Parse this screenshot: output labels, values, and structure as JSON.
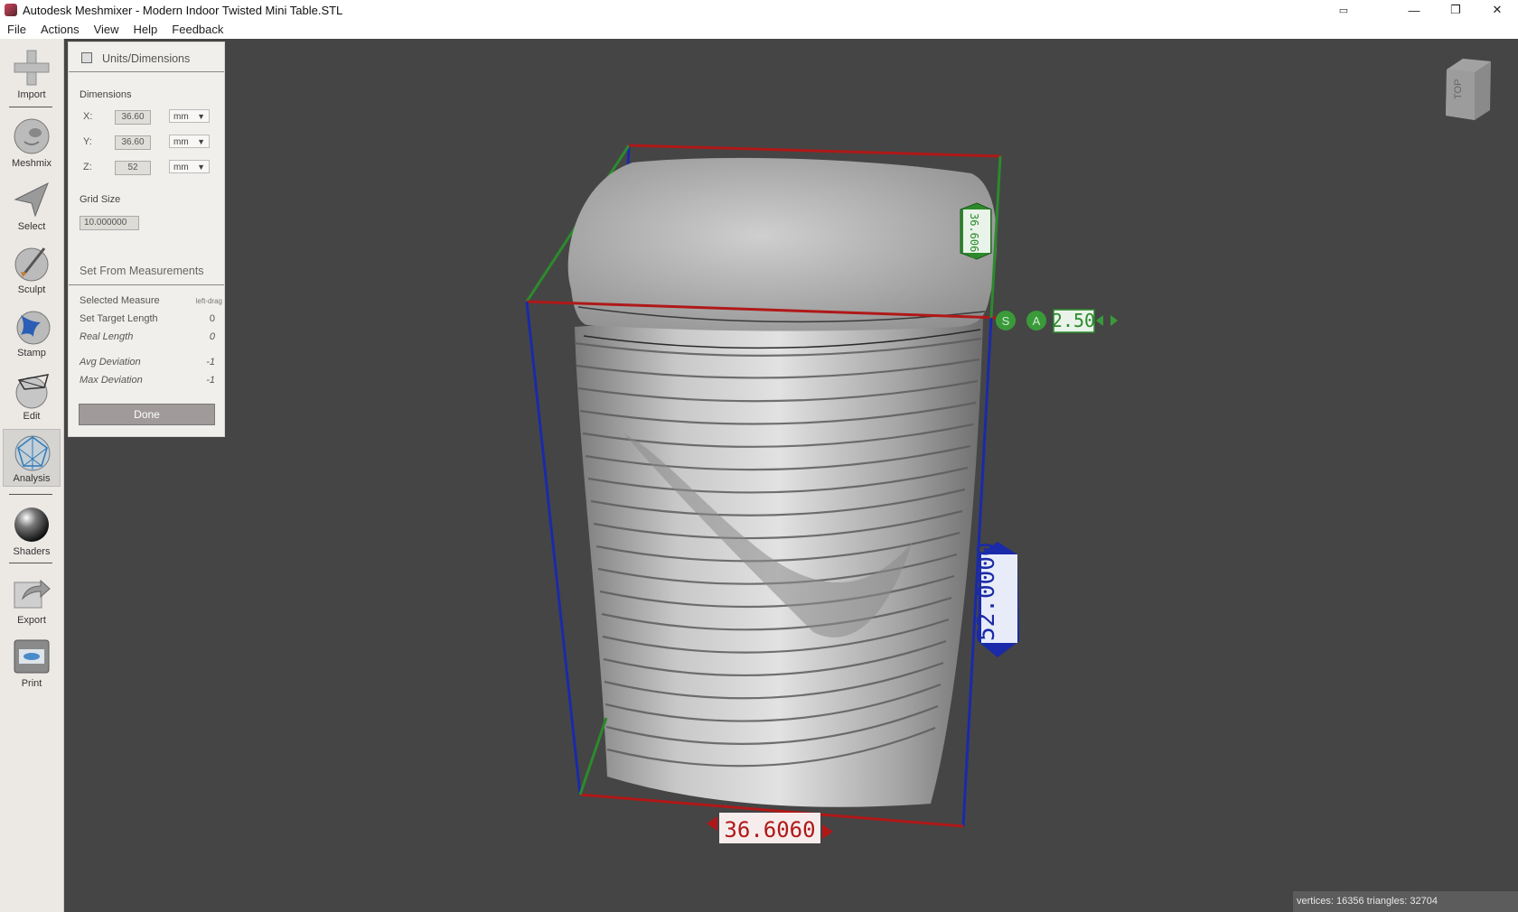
{
  "window": {
    "title": "Autodesk Meshmixer - Modern Indoor Twisted Mini Table.STL",
    "controls": {
      "extra": "▭",
      "minimize": "—",
      "maximize": "❐",
      "close": "✕"
    }
  },
  "menu": [
    "File",
    "Actions",
    "View",
    "Help",
    "Feedback"
  ],
  "toolbar": {
    "tools": [
      {
        "label": "Import",
        "icon": "plus-icon"
      },
      {
        "label": "Meshmix",
        "icon": "meshmix-icon"
      },
      {
        "label": "Select",
        "icon": "select-arrow-icon"
      },
      {
        "label": "Sculpt",
        "icon": "sculpt-brush-icon"
      },
      {
        "label": "Stamp",
        "icon": "stamp-icon"
      },
      {
        "label": "Edit",
        "icon": "edit-icon"
      },
      {
        "label": "Analysis",
        "icon": "analysis-icon",
        "active": true
      },
      {
        "label": "Shaders",
        "icon": "shaders-sphere-icon"
      },
      {
        "label": "Export",
        "icon": "export-icon"
      },
      {
        "label": "Print",
        "icon": "printer-icon"
      }
    ]
  },
  "panel": {
    "title": "Units/Dimensions",
    "dimensions_label": "Dimensions",
    "x": {
      "label": "X:",
      "value": "36.60",
      "unit": "mm"
    },
    "y": {
      "label": "Y:",
      "value": "36.60",
      "unit": "mm"
    },
    "z": {
      "label": "Z:",
      "value": "52",
      "unit": "mm"
    },
    "grid_size_label": "Grid Size",
    "grid_size_value": "10.000000",
    "set_from_measurements": "Set From Measurements",
    "selected_measure": {
      "label": "Selected Measure",
      "value": "left-drag"
    },
    "set_target_length": {
      "label": "Set Target Length",
      "value": "0"
    },
    "real_length": {
      "label": "Real Length",
      "value": "0"
    },
    "avg_deviation": {
      "label": "Avg Deviation",
      "value": "-1"
    },
    "max_deviation": {
      "label": "Max Deviation",
      "value": "-1"
    },
    "done_label": "Done"
  },
  "viewport": {
    "dim_x": "36.6060",
    "dim_y": "36.6060",
    "dim_z": "52.0000",
    "scale_value": "2.50",
    "scale_s": "S",
    "scale_a": "A",
    "view_cube_label": "TOP"
  },
  "status": "vertices: 16356 triangles: 32704",
  "colors": {
    "x_axis": "#b01818",
    "y_axis": "#2c8a2c",
    "z_axis": "#1a2aa8",
    "background": "#454545"
  }
}
